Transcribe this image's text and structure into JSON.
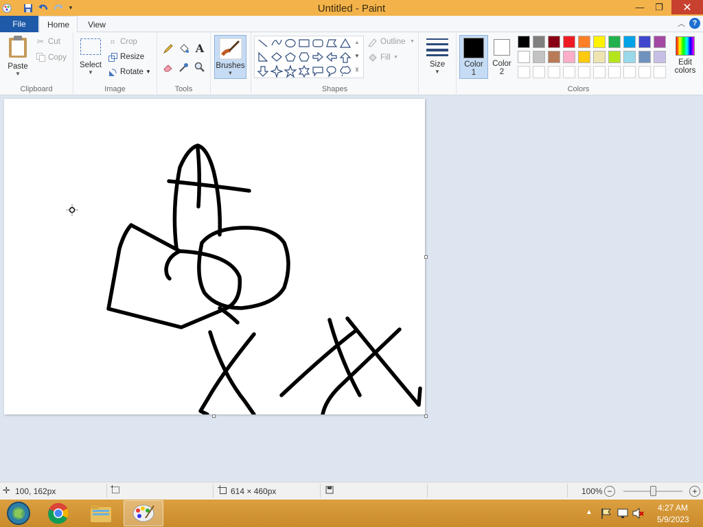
{
  "window": {
    "title": "Untitled - Paint"
  },
  "tabs": {
    "file": "File",
    "home": "Home",
    "view": "View"
  },
  "clipboard": {
    "paste": "Paste",
    "cut": "Cut",
    "copy": "Copy",
    "group": "Clipboard"
  },
  "image": {
    "select": "Select",
    "crop": "Crop",
    "resize": "Resize",
    "rotate": "Rotate",
    "group": "Image"
  },
  "tools": {
    "group": "Tools",
    "text_tool": "A"
  },
  "brushes": {
    "label": "Brushes"
  },
  "shapes": {
    "outline": "Outline",
    "fill": "Fill",
    "group": "Shapes"
  },
  "size": {
    "label": "Size"
  },
  "color1": {
    "label_line1": "Color",
    "label_line2": "1",
    "value": "#000000"
  },
  "color2": {
    "label_line1": "Color",
    "label_line2": "2",
    "value": "#ffffff"
  },
  "colors": {
    "group": "Colors",
    "edit_line1": "Edit",
    "edit_line2": "colors",
    "palette_row1": [
      "#000000",
      "#7f7f7f",
      "#880015",
      "#ed1c24",
      "#ff7f27",
      "#fff200",
      "#22b14c",
      "#00a2e8",
      "#3f48cc",
      "#a349a4"
    ],
    "palette_row2": [
      "#ffffff",
      "#c3c3c3",
      "#b97a57",
      "#ffaec9",
      "#ffc90e",
      "#efe4b0",
      "#b5e61d",
      "#99d9ea",
      "#7092be",
      "#c8bfe7"
    ]
  },
  "status": {
    "cursor_position": "100, 162px",
    "image_size": "614 × 460px",
    "zoom": "100%",
    "zoom_level_fraction": 0.5
  },
  "taskbar": {
    "time": "4:27 AM",
    "date": "5/9/2023"
  }
}
